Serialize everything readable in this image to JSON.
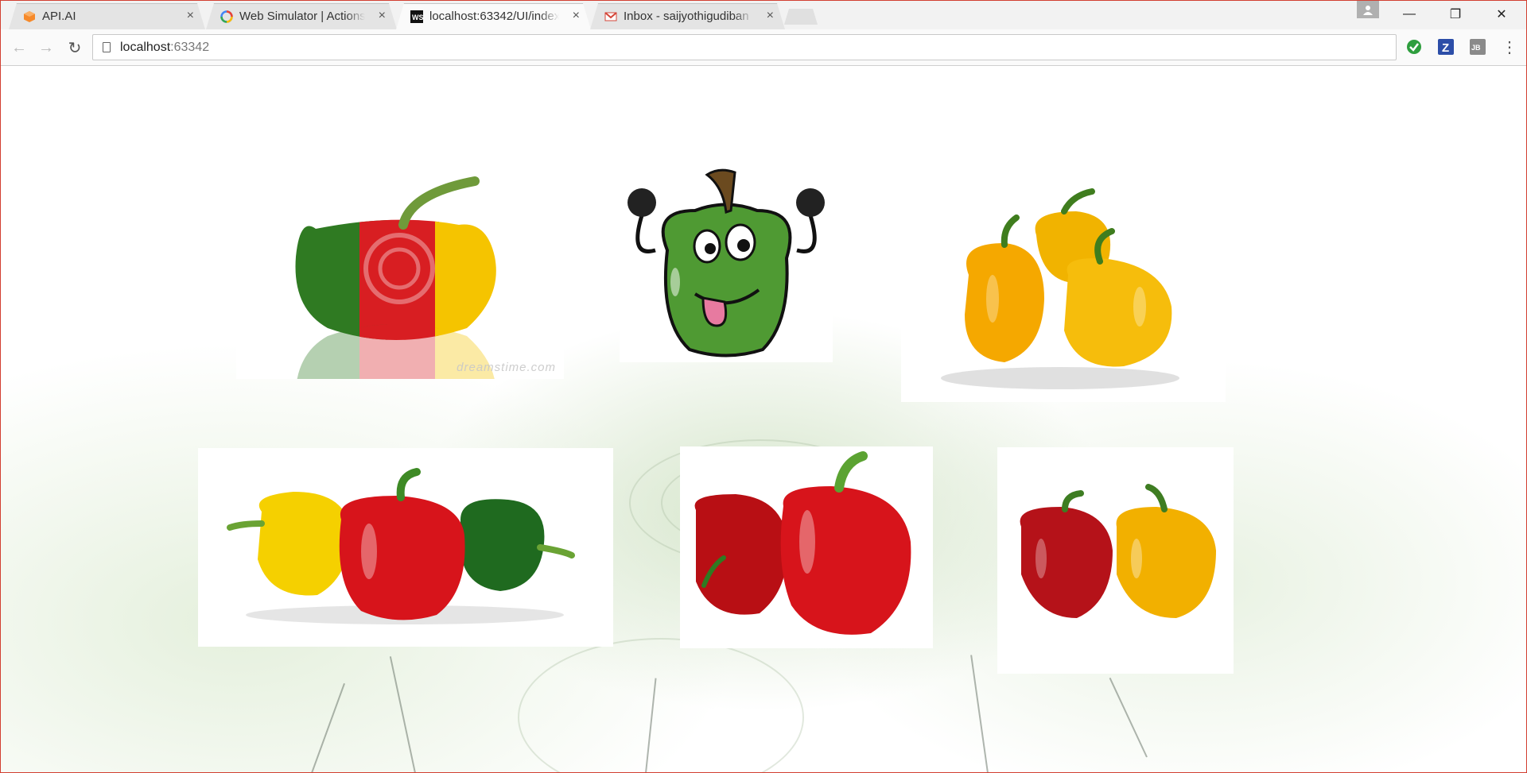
{
  "browser": {
    "tabs": [
      {
        "title": "API.AI",
        "icon": "api-ai-icon",
        "active": false
      },
      {
        "title": "Web Simulator  |  Actions",
        "icon": "google-actions-icon",
        "active": false
      },
      {
        "title": "localhost:63342/UI/index",
        "icon": "webstorm-icon",
        "active": true
      },
      {
        "title": "Inbox - saijyothigudiban",
        "icon": "gmail-icon",
        "active": false
      }
    ],
    "close_glyph": "×",
    "address": {
      "host": "localhost",
      "port": ":63342"
    },
    "window_controls": {
      "minimize": "—",
      "restore": "❐",
      "close": "✕"
    },
    "nav": {
      "back": "←",
      "forward": "→",
      "reload": "↻"
    },
    "menu_glyph": "⋮"
  },
  "page": {
    "images": [
      {
        "subject": "tricolor-pepper",
        "watermark": "dreamstime.com"
      },
      {
        "subject": "cartoon-green-pepper"
      },
      {
        "subject": "yellow-peppers"
      },
      {
        "subject": "yellow-red-green-peppers"
      },
      {
        "subject": "red-peppers"
      },
      {
        "subject": "red-and-yellow-peppers"
      }
    ]
  },
  "colors": {
    "frame_accent": "#d23f31",
    "pepper_red": "#d81e22",
    "pepper_yellow": "#f5c400",
    "pepper_green": "#2f7a22"
  }
}
